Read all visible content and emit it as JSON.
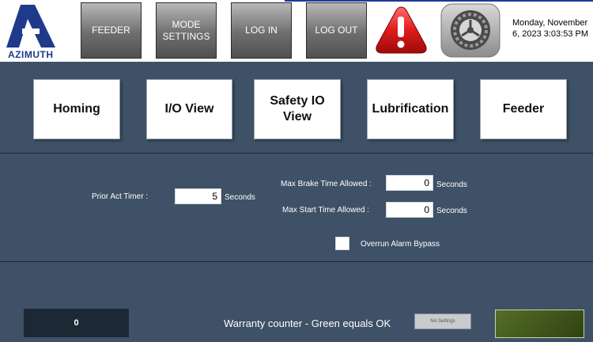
{
  "header": {
    "logo_text": "AZIMUTH",
    "buttons": {
      "feeder": "FEEDER",
      "mode_settings": "MODE\nSETTINGS",
      "log_in": "LOG IN",
      "log_out": "LOG OUT"
    },
    "icons": {
      "alarm": "alarm-icon",
      "settings": "gear-icon"
    },
    "datetime_line1": "Monday, November",
    "datetime_line2": "6, 2023 3:03:53 PM"
  },
  "nav": {
    "homing": "Homing",
    "io_view": "I/O View",
    "safety_io_view": "Safety IO\nView",
    "lubrication": "Lubrification",
    "feeder": "Feeder"
  },
  "settings": {
    "prior_act_timer_label": "Prior Act Timer :",
    "prior_act_timer_value": "5",
    "max_brake_label": "Max Brake Time Allowed :",
    "max_brake_value": "0",
    "max_start_label": "Max Start Time Allowed :",
    "max_start_value": "0",
    "unit": "Seconds",
    "overrun_label": "Overrun Alarm Bypass",
    "overrun_checked": false
  },
  "footer": {
    "counter_value": "0",
    "warranty_text": "Warranty counter - Green equals OK",
    "na_settings": "NA Settings",
    "status_color": "#4a6320"
  },
  "colors": {
    "background": "#3e5166",
    "header_bg": "#ffffff",
    "logo_blue": "#1f3a8a",
    "alarm_red": "#e01b1b"
  }
}
